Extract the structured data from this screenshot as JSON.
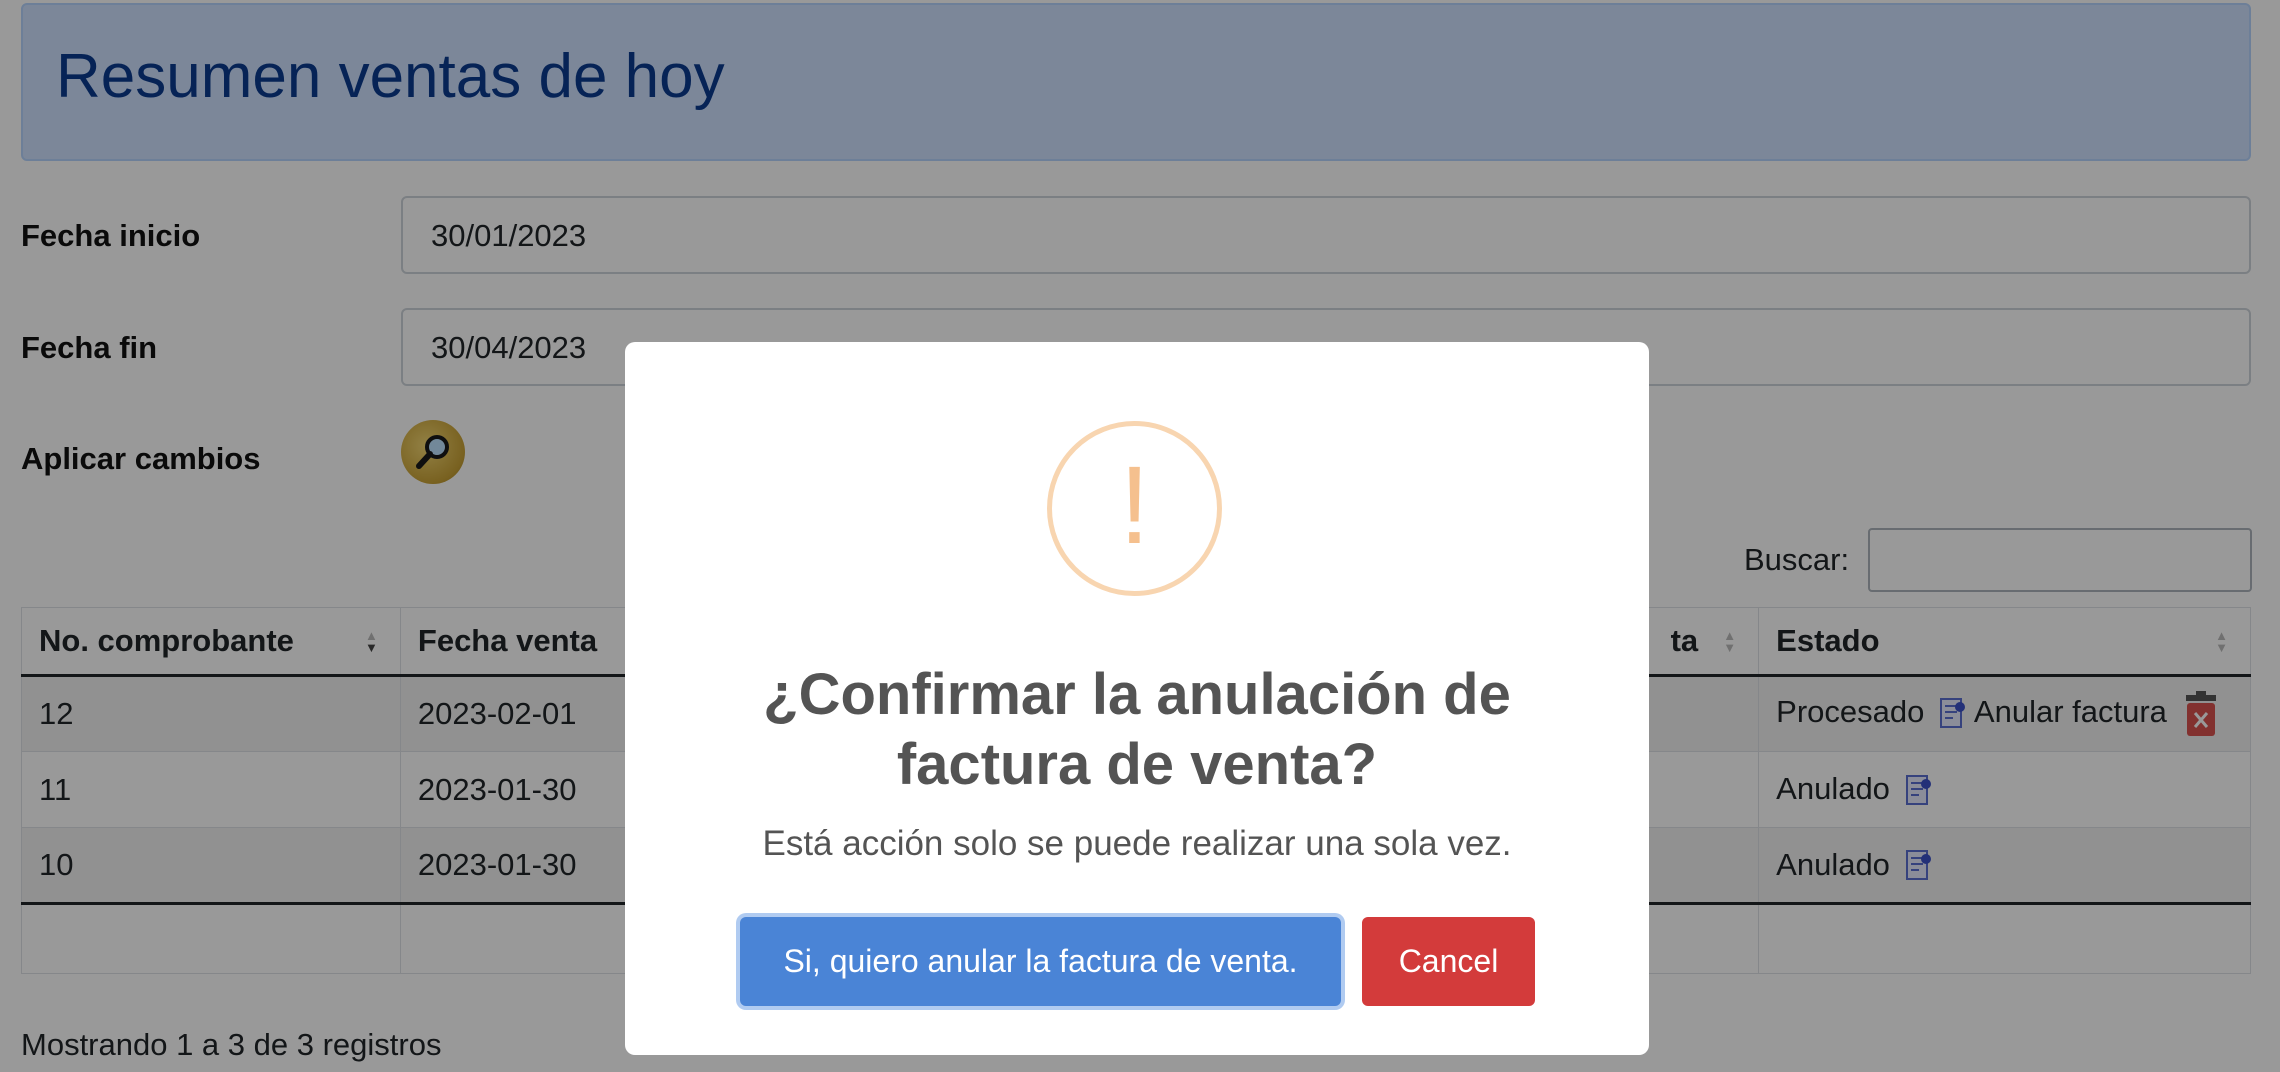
{
  "header": {
    "title": "Resumen ventas de hoy"
  },
  "filters": {
    "start_label": "Fecha inicio",
    "start_value": "30/01/2023",
    "end_label": "Fecha fin",
    "end_value": "30/04/2023",
    "apply_label": "Aplicar cambios"
  },
  "search": {
    "label": "Buscar:",
    "value": ""
  },
  "table": {
    "headers": [
      "No. comprobante",
      "Fecha venta",
      "",
      "ta",
      "Estado"
    ],
    "rows": [
      {
        "id": "12",
        "date": "2023-02-01",
        "status": "Procesado",
        "action": "Anular factura"
      },
      {
        "id": "11",
        "date": "2023-01-30",
        "status": "Anulado",
        "action": ""
      },
      {
        "id": "10",
        "date": "2023-01-30",
        "status": "Anulado",
        "action": ""
      }
    ]
  },
  "footer": {
    "showing": "Mostrando 1 a 3 de 3 registros"
  },
  "modal": {
    "icon": "!",
    "title": "¿Confirmar la anulación de factura de venta?",
    "text": "Está acción solo se puede realizar una sola vez.",
    "confirm_label": "Si, quiero anular la factura de venta.",
    "cancel_label": "Cancel"
  },
  "colors": {
    "banner_bg": "#cfe2ff",
    "banner_text": "#0a3b8f",
    "confirm_bg": "#4a84d6",
    "cancel_bg": "#d33b3b",
    "warning": "#f5c08e"
  }
}
